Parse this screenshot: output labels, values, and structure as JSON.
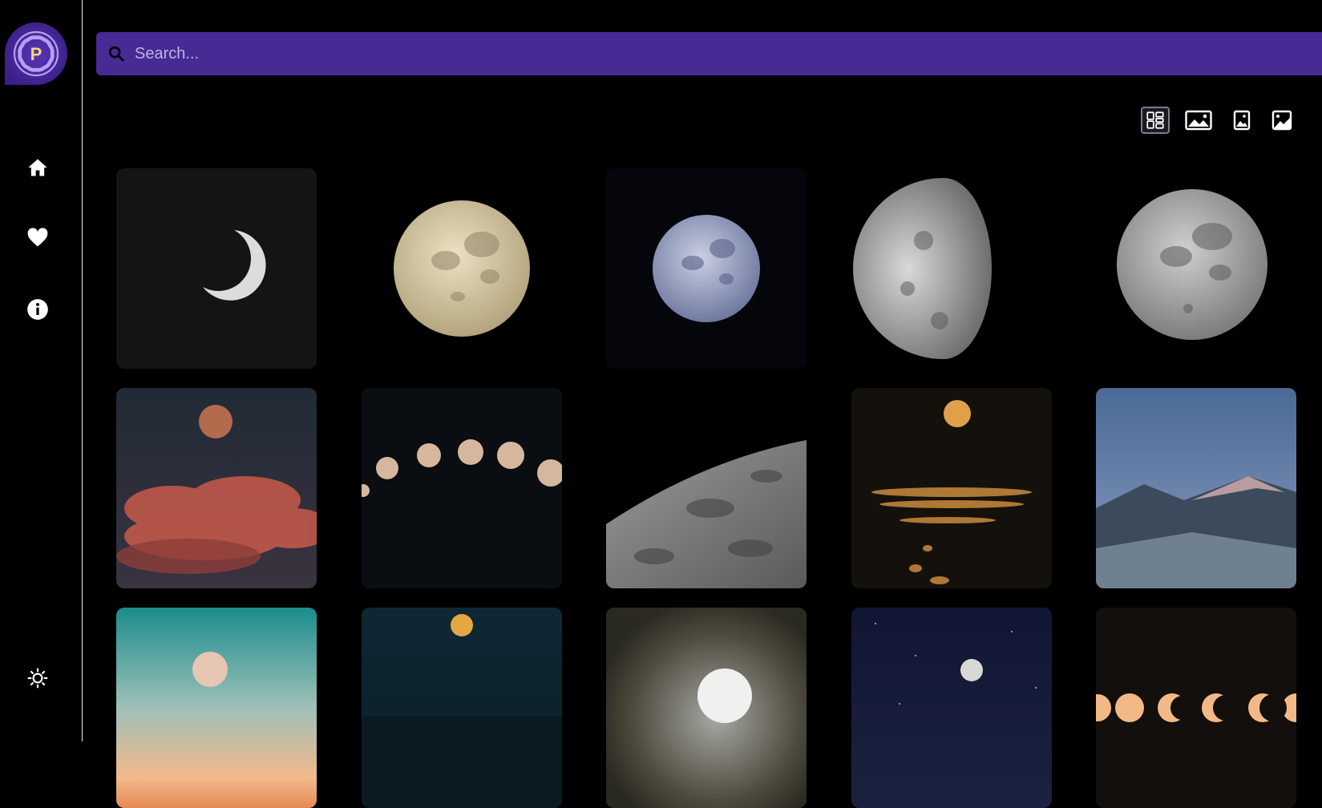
{
  "app": {
    "logo_letter": "P"
  },
  "sidebar": {
    "nav": [
      {
        "id": "home",
        "icon": "home-icon"
      },
      {
        "id": "favorites",
        "icon": "heart-icon"
      },
      {
        "id": "info",
        "icon": "info-icon"
      }
    ],
    "theme_toggle_icon": "sun-icon"
  },
  "search": {
    "placeholder": "Search...",
    "value": ""
  },
  "view_options": [
    {
      "icon": "masonry-grid-icon",
      "active": true
    },
    {
      "icon": "landscape-image-icon",
      "active": false
    },
    {
      "icon": "portrait-image-icon",
      "active": false
    },
    {
      "icon": "square-image-icon",
      "active": false
    }
  ],
  "colors": {
    "accent": "#472a94",
    "background": "#000000",
    "logo_letter": "#f2d77a"
  },
  "gallery": {
    "images": [
      "crescent-moon-dark",
      "full-moon-golden",
      "full-moon-blue",
      "half-moon-gray",
      "full-moon-gray",
      "red-moon-over-clouds",
      "moon-phases-arc",
      "lunar-surface-craters",
      "moon-over-sea-lights",
      "crescent-moon-over-mountains",
      "moon-in-teal-sunset-sky",
      "moon-over-night-sea",
      "full-moon-in-clouds",
      "moon-in-starry-sky",
      "lunar-eclipse-phases"
    ]
  }
}
